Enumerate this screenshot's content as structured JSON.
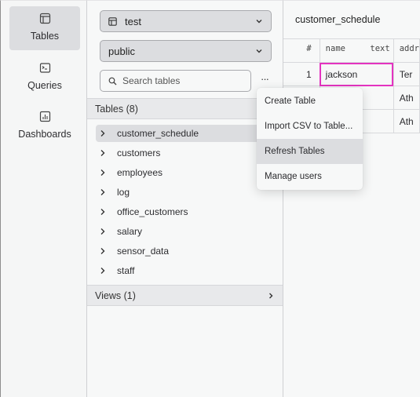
{
  "nav": {
    "items": [
      {
        "label": "Tables",
        "icon": "table-icon",
        "active": true
      },
      {
        "label": "Queries",
        "icon": "terminal-icon",
        "active": false
      },
      {
        "label": "Dashboards",
        "icon": "bar-chart-icon",
        "active": false
      }
    ]
  },
  "sidebar": {
    "database_select": {
      "value": "test",
      "icon": "database-icon"
    },
    "schema_select": {
      "value": "public"
    },
    "search": {
      "placeholder": "Search tables",
      "value": ""
    },
    "more_label": "···",
    "tables_header": "Tables (8)",
    "tables": [
      {
        "name": "customer_schedule",
        "selected": true
      },
      {
        "name": "customers",
        "selected": false
      },
      {
        "name": "employees",
        "selected": false
      },
      {
        "name": "log",
        "selected": false
      },
      {
        "name": "office_customers",
        "selected": false
      },
      {
        "name": "salary",
        "selected": false
      },
      {
        "name": "sensor_data",
        "selected": false
      },
      {
        "name": "staff",
        "selected": false
      }
    ],
    "views_header": "Views (1)"
  },
  "main": {
    "title": "customer_schedule",
    "columns": [
      {
        "label": "#",
        "type": ""
      },
      {
        "label": "name",
        "type": "text"
      },
      {
        "label": "addr",
        "type": ""
      }
    ],
    "rows": [
      {
        "index": "1",
        "name": "jackson",
        "addr": "Ter"
      },
      {
        "index": "",
        "name": "",
        "addr": "Ath"
      },
      {
        "index": "",
        "name": "",
        "addr": "Ath"
      }
    ],
    "focus_color": "#e433c0"
  },
  "context_menu": {
    "items": [
      {
        "label": "Create Table",
        "hover": false
      },
      {
        "label": "Import CSV to Table...",
        "hover": false
      },
      {
        "label": "Refresh Tables",
        "hover": true
      },
      {
        "label": "Manage users",
        "hover": false
      }
    ]
  }
}
